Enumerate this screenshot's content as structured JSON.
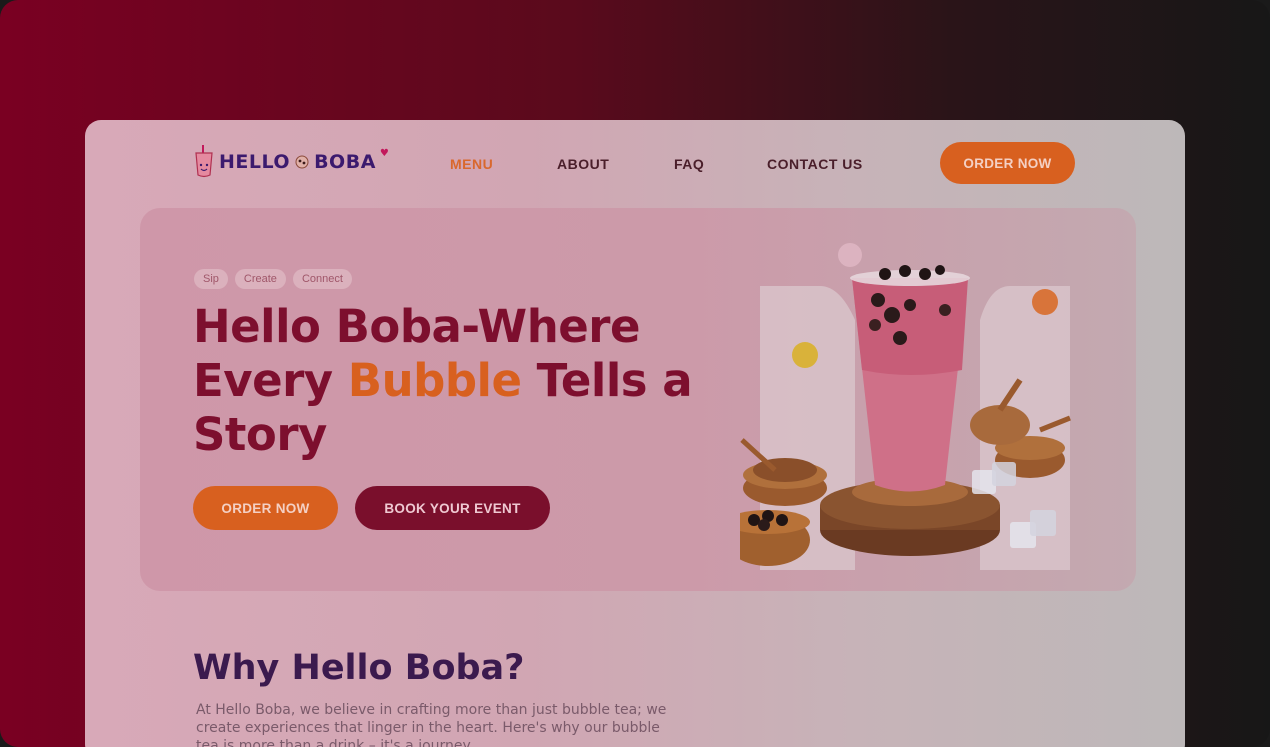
{
  "brand": {
    "name_part1": "HELLO",
    "name_part2": "BOBA"
  },
  "nav": {
    "items": [
      {
        "label": "MENU",
        "active": true
      },
      {
        "label": "ABOUT",
        "active": false
      },
      {
        "label": "FAQ",
        "active": false
      },
      {
        "label": "CONTACT US",
        "active": false
      }
    ],
    "cta": "ORDER NOW"
  },
  "hero": {
    "tags": [
      "Sip",
      "Create",
      "Connect"
    ],
    "headline_before": "Hello Boba-Where Every ",
    "headline_accent": "Bubble",
    "headline_after": " Tells a Story",
    "primary_cta": "ORDER NOW",
    "secondary_cta": "BOOK YOUR EVENT"
  },
  "why": {
    "title_light": "Why ",
    "title_bold": "Hello Boba?",
    "body": "At Hello Boba, we believe in crafting more than just bubble tea; we create experiences that linger in the heart. Here's why our bubble tea is more than a drink – it's a journey."
  },
  "colors": {
    "accent_orange": "#d8601f",
    "maroon": "#7a0f2c",
    "brand_purple": "#3b1a6e"
  }
}
